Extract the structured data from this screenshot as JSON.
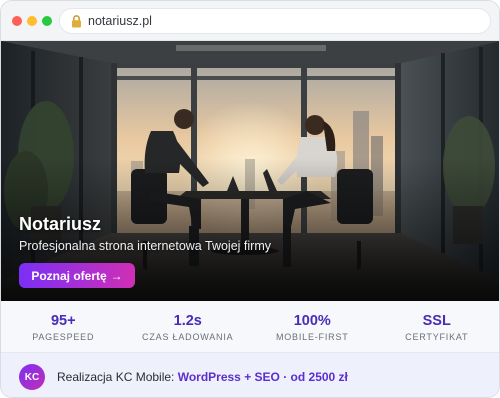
{
  "browser": {
    "url": "notariusz.pl"
  },
  "hero": {
    "title": "Notariusz",
    "subtitle": "Profesjonalna strona internetowa Twojej firmy",
    "cta_label": "Poznaj ofertę",
    "cta_arrow": "→"
  },
  "stats": [
    {
      "value": "95+",
      "label": "PAGESPEED"
    },
    {
      "value": "1.2s",
      "label": "CZAS ŁADOWANIA"
    },
    {
      "value": "100%",
      "label": "MOBILE-FIRST"
    },
    {
      "value": "SSL",
      "label": "CERTYFIKAT"
    }
  ],
  "footer": {
    "avatar_initials": "KC",
    "text_prefix": "Realizacja KC Mobile: ",
    "text_highlight": "WordPress + SEO · od 2500 zł"
  },
  "colors": {
    "accent": "#4b2bb8",
    "cta_gradient_start": "#7b2ff7",
    "cta_gradient_end": "#d02fb5"
  }
}
